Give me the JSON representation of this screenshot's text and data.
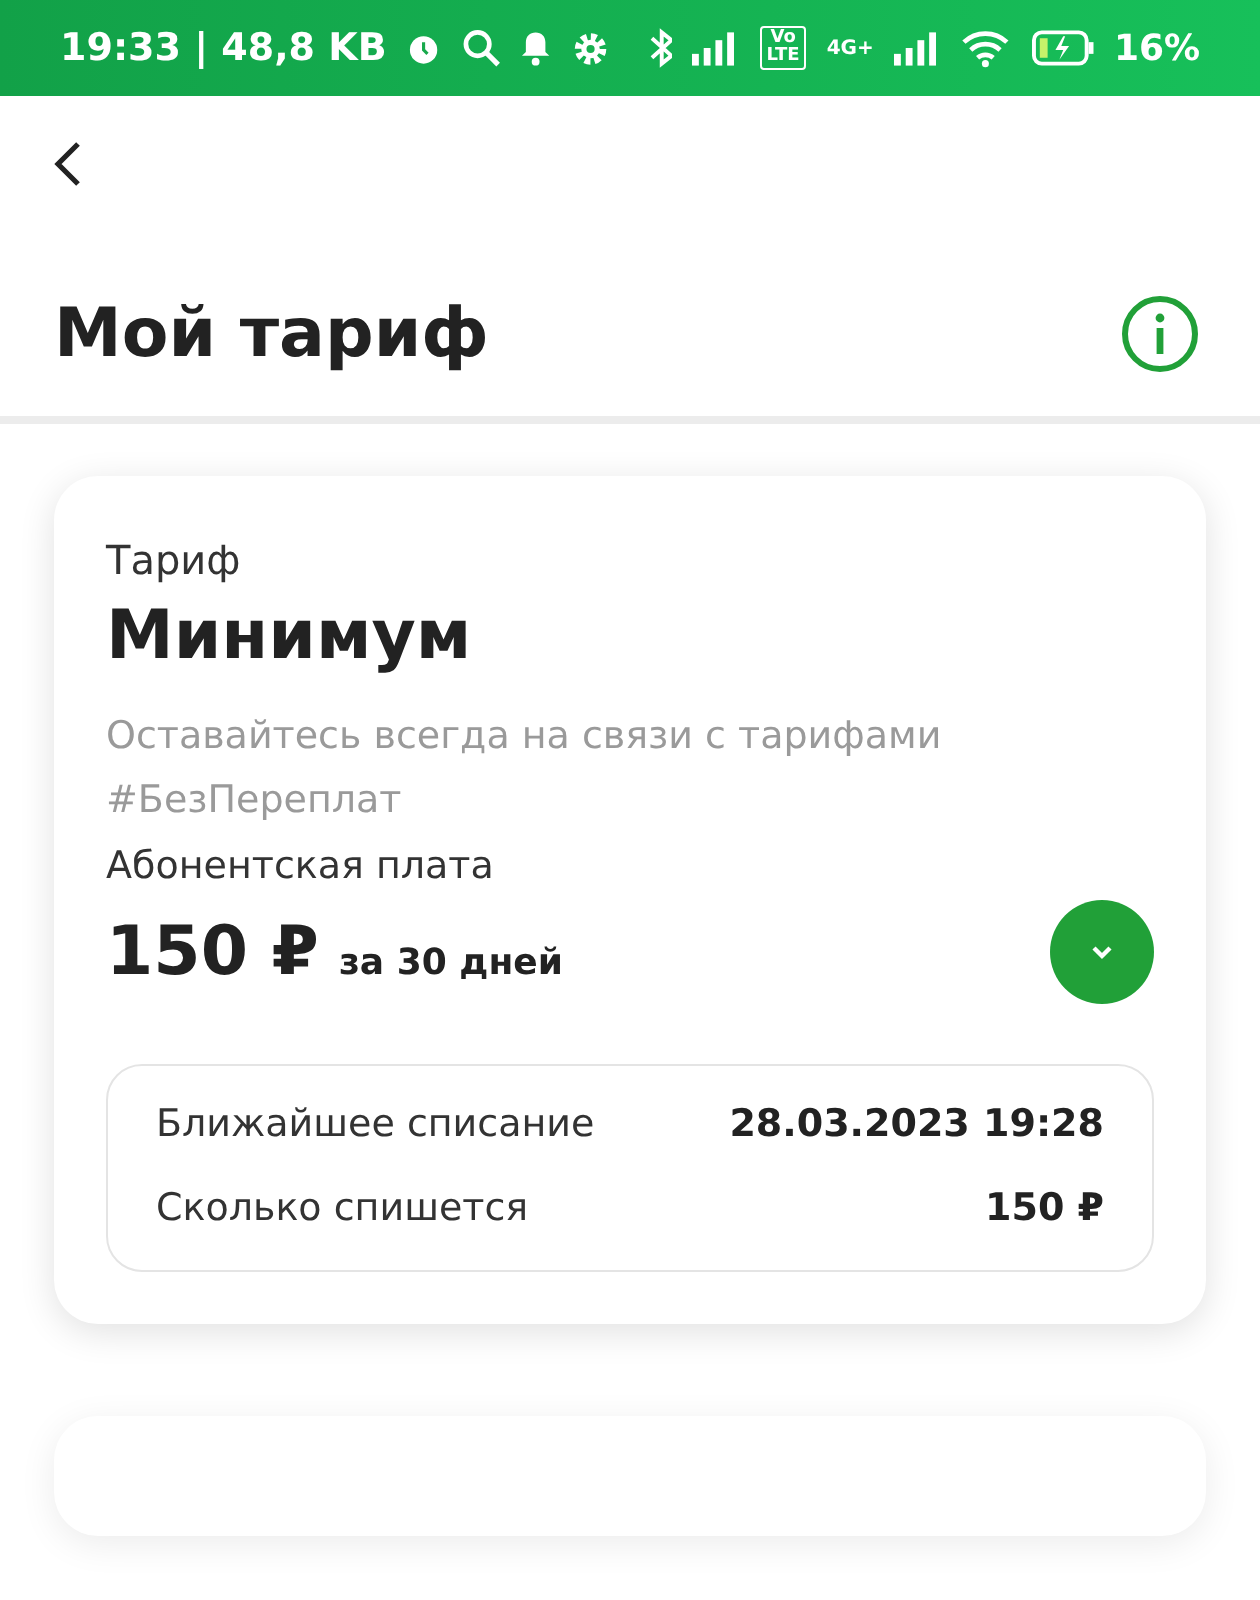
{
  "status_bar": {
    "time": "19:33 | 48,8 KB",
    "network": "4G+",
    "volte": "Vo LTE",
    "battery": "16%"
  },
  "header": {
    "title": "Мой тариф"
  },
  "tariff_card": {
    "label": "Тариф",
    "name": "Минимум",
    "description": "Оставайтесь всегда на связи с тарифами #БезПереплат",
    "fee_label": "Абонентская плата",
    "price": "150 ₽",
    "period": "за 30 дней",
    "expanded": false,
    "details": [
      {
        "label": "Ближайшее списание",
        "value": "28.03.2023 19:28"
      },
      {
        "label": "Сколько спишется",
        "value": "150 ₽"
      }
    ]
  }
}
